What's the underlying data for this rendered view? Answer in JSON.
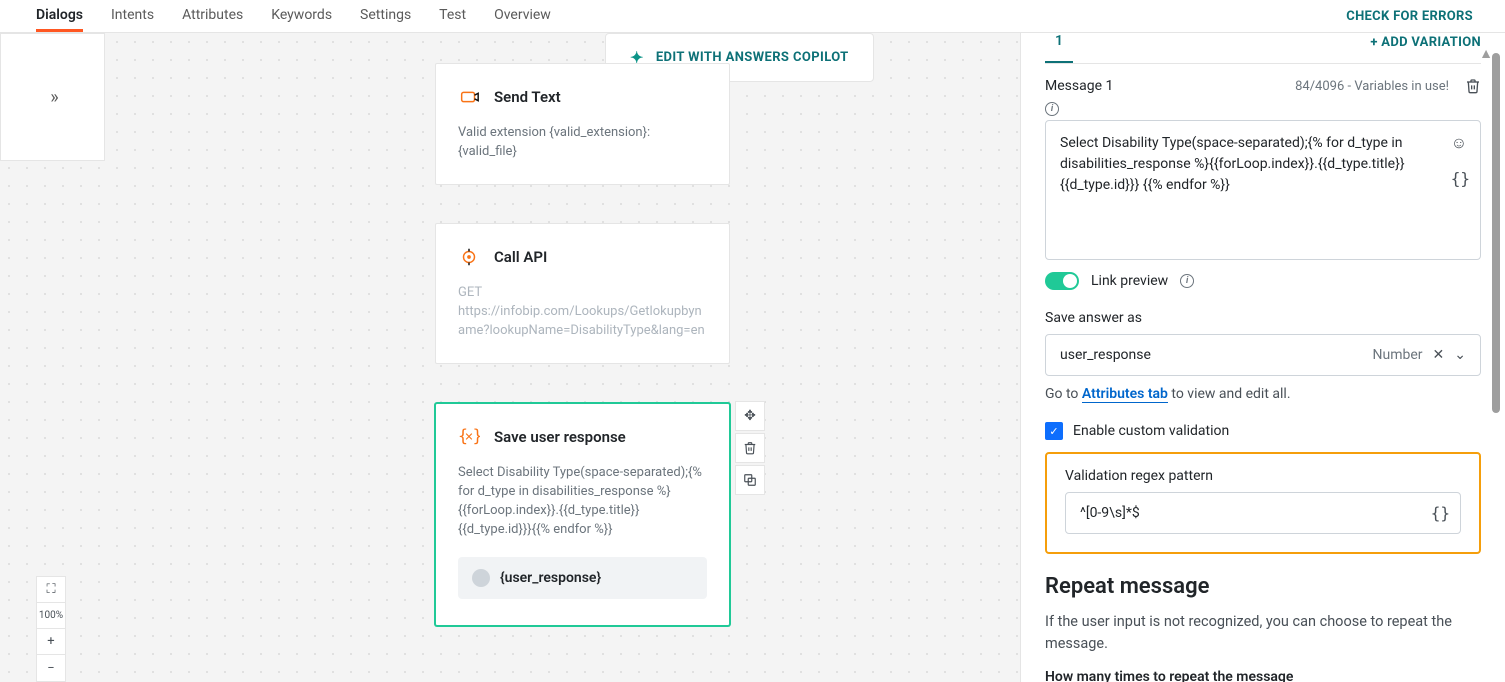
{
  "nav": {
    "tabs": [
      "Dialogs",
      "Intents",
      "Attributes",
      "Keywords",
      "Settings",
      "Test",
      "Overview"
    ],
    "active_index": 0,
    "check_errors": "CHECK FOR ERRORS"
  },
  "copilot_label": "EDIT WITH ANSWERS COPILOT",
  "cards": {
    "send_text": {
      "title": "Send Text",
      "body": "Valid extension {valid_extension}: {valid_file}"
    },
    "call_api": {
      "title": "Call API",
      "body": "GET https://infobip.com/Lookups/Getlokupbyname?lookupName=DisabilityType&lang=en"
    },
    "save_user_response": {
      "title": "Save user response",
      "body": "Select Disability Type(space-separated);{% for d_type in disabilities_response %}{{forLoop.index}}.{{d_type.title}}{{d_type.id}}}{{% endfor %}}",
      "chip": "{user_response}"
    }
  },
  "zoom": {
    "percent": "100%"
  },
  "panel": {
    "variation_tab": "1",
    "add_variation": "+ ADD VARIATION",
    "message_label": "Message 1",
    "counter": "84/4096 - Variables in use!",
    "message_body": "Select Disability Type(space-separated);{% for d_type in disabilities_response %}{{forLoop.index}}.{{d_type.title}}{{d_type.id}}} {{% endfor %}}",
    "link_preview_label": "Link preview",
    "save_answer_label": "Save answer as",
    "save_answer_value": "user_response",
    "save_answer_type": "Number",
    "hint_prefix": "Go to ",
    "hint_link": "Attributes tab",
    "hint_suffix": " to view and edit all.",
    "enable_validation": "Enable custom validation",
    "validation_regex_label": "Validation regex pattern",
    "validation_regex_value": "^[0-9\\s]*$",
    "repeat_heading": "Repeat message",
    "repeat_para": "If the user input is not recognized, you can choose to repeat the message.",
    "repeat_times_label": "How many times to repeat the message"
  }
}
